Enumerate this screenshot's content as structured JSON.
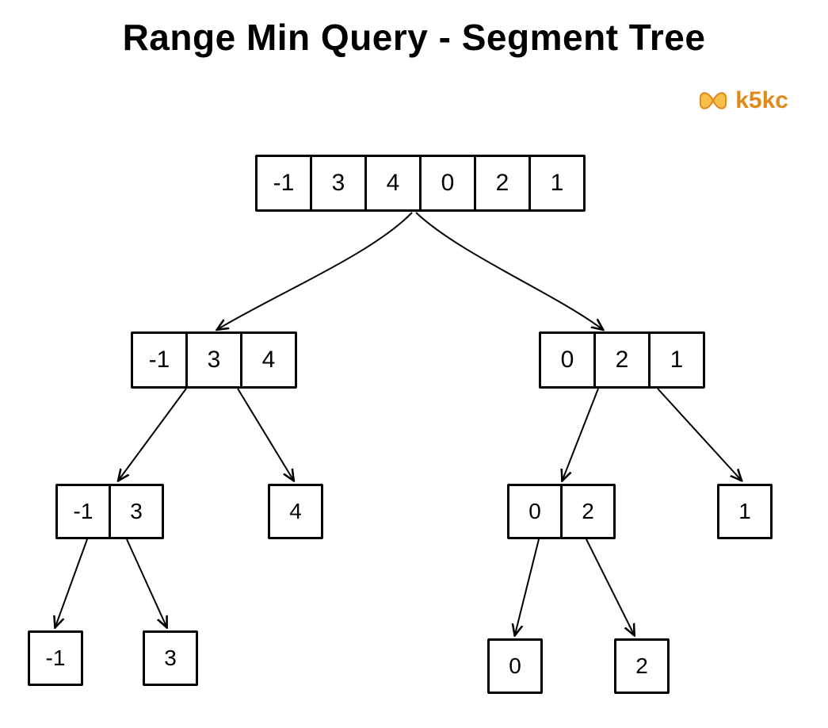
{
  "title": "Range Min Query - Segment Tree",
  "brand": "k5kc",
  "tree": {
    "root": [
      "-1",
      "3",
      "4",
      "0",
      "2",
      "1"
    ],
    "left": [
      "-1",
      "3",
      "4"
    ],
    "right": [
      "0",
      "2",
      "1"
    ],
    "ll": [
      "-1",
      "3"
    ],
    "lr": [
      "4"
    ],
    "rl": [
      "0",
      "2"
    ],
    "rr": [
      "1"
    ],
    "lll": [
      "-1"
    ],
    "llr": [
      "3"
    ],
    "rll": [
      "0"
    ],
    "rlr": [
      "2"
    ]
  },
  "chart_data": {
    "type": "diagram",
    "description": "Segment tree decomposition for range minimum query over input array",
    "input_array": [
      -1,
      3,
      4,
      0,
      2,
      1
    ],
    "nodes": [
      {
        "id": "root",
        "values": [
          -1,
          3,
          4,
          0,
          2,
          1
        ],
        "children": [
          "left",
          "right"
        ]
      },
      {
        "id": "left",
        "values": [
          -1,
          3,
          4
        ],
        "children": [
          "ll",
          "lr"
        ]
      },
      {
        "id": "right",
        "values": [
          0,
          2,
          1
        ],
        "children": [
          "rl",
          "rr"
        ]
      },
      {
        "id": "ll",
        "values": [
          -1,
          3
        ],
        "children": [
          "lll",
          "llr"
        ]
      },
      {
        "id": "lr",
        "values": [
          4
        ],
        "children": []
      },
      {
        "id": "rl",
        "values": [
          0,
          2
        ],
        "children": [
          "rll",
          "rlr"
        ]
      },
      {
        "id": "rr",
        "values": [
          1
        ],
        "children": []
      },
      {
        "id": "lll",
        "values": [
          -1
        ],
        "children": []
      },
      {
        "id": "llr",
        "values": [
          3
        ],
        "children": []
      },
      {
        "id": "rll",
        "values": [
          0
        ],
        "children": []
      },
      {
        "id": "rlr",
        "values": [
          2
        ],
        "children": []
      }
    ]
  }
}
